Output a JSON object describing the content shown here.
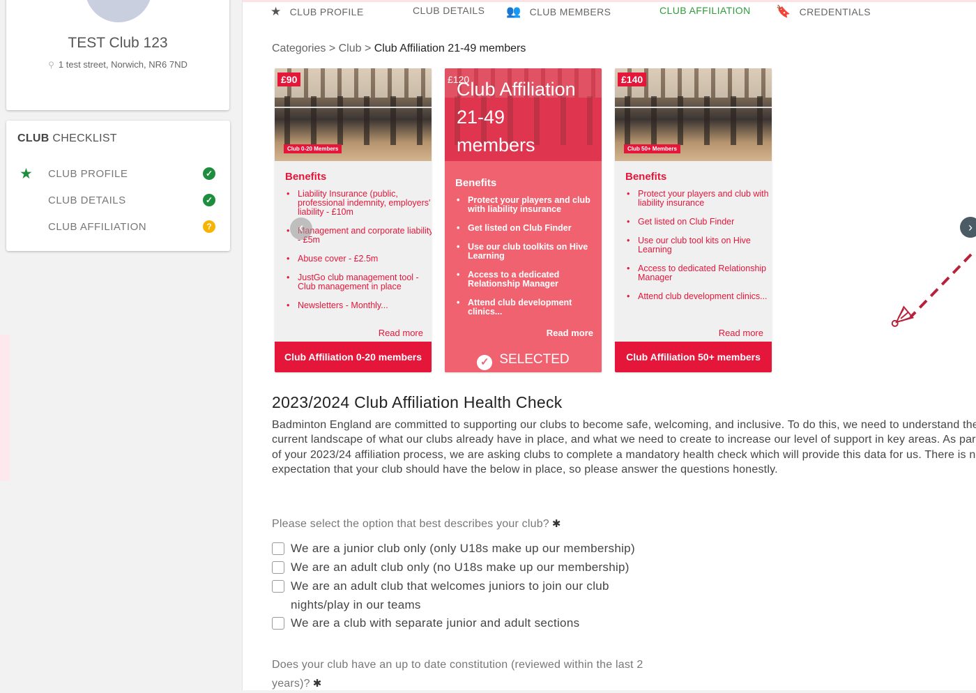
{
  "club": {
    "name": "TEST Club 123",
    "address": "1 test street, Norwich, NR6 7ND"
  },
  "checklist": {
    "title_bold": "CLUB",
    "title_rest": " CHECKLIST",
    "items": [
      {
        "label": "CLUB PROFILE",
        "status": "complete"
      },
      {
        "label": "CLUB DETAILS",
        "status": "complete"
      },
      {
        "label": "CLUB AFFILIATION",
        "status": "pending"
      }
    ]
  },
  "tabs": [
    {
      "label": "CLUB PROFILE",
      "icon": "star-icon"
    },
    {
      "label": "CLUB DETAILS",
      "icon": ""
    },
    {
      "label": "CLUB MEMBERS",
      "icon": "members-icon"
    },
    {
      "label": "CLUB AFFILIATION",
      "icon": "",
      "active": true
    },
    {
      "label": "CREDENTIALS",
      "icon": "bookmark-icon"
    }
  ],
  "breadcrumb": {
    "part1": "Categories",
    "sep1": " > ",
    "part2": "Club",
    "sep2": " > ",
    "current": "Club Affiliation 21-49 members"
  },
  "packages": [
    {
      "price": "£90",
      "badge": "Club 0-20 Members",
      "benefits_title": "Benefits",
      "benefits": [
        "Liability Insurance (public, professional indemnity, employers' liability - £10m",
        "Management and corporate liability - £5m",
        "Abuse cover - £2.5m",
        "JustGo club management tool - Club management in place",
        "Newsletters - Monthly..."
      ],
      "read_more": "Read more",
      "footer": "Club Affiliation 0-20 members"
    },
    {
      "price": "£120",
      "title_line1": "Club Affiliation",
      "title_line2": "21-49",
      "title_line3": "members",
      "benefits_title": "Benefits",
      "benefits": [
        "Protect your players and club with liability insurance",
        "Get listed on Club Finder",
        "Use our club toolkits on Hive Learning",
        "Access to a dedicated Relationship Manager",
        "Attend club development clinics..."
      ],
      "read_more": "Read more",
      "footer": "SELECTED"
    },
    {
      "price": "£140",
      "badge": "Club 50+ Members",
      "benefits_title": "Benefits",
      "benefits": [
        "Protect your players and club with liability insurance",
        "Get listed on Club Finder",
        "Use our club tool kits on Hive Learning",
        "Access to dedicated Relationship Manager",
        "Attend club development clinics..."
      ],
      "read_more": "Read more",
      "footer": "Club Affiliation 50+ members"
    }
  ],
  "health_check": {
    "title": "2023/2024 Club Affiliation Health Check",
    "body": "Badminton England are committed to supporting our clubs to become safe, welcoming, and inclusive. To do this, we need to understand the current landscape of what our clubs already have in place, and what we need to create to increase our level of support in key areas. As part of your 2023/24 affiliation process, we are asking clubs to complete a mandatory health check which will provide this data for us. There is no expectation that your club should have the below in place, so please answer the questions honestly.",
    "q1": {
      "text": "Please select the option that best describes your club?",
      "required_mark": "✱",
      "options": [
        "We are a junior club only (only U18s make up our membership)",
        "We are an adult club only (no U18s make up our membership)",
        "We are an adult club that welcomes juniors to join our club nights/play in our teams",
        "We are a club with separate junior and adult sections"
      ]
    },
    "q2": {
      "text": "Does your club have an up to date constitution (reviewed within the last 2 years)?",
      "required_mark": "✱"
    }
  },
  "colors": {
    "brand_red": "#e4163a",
    "selected_pink": "#f0626f",
    "success_green": "#1e8e3e",
    "pending_amber": "#f6b400",
    "active_tab_green": "#2e9b3a"
  }
}
